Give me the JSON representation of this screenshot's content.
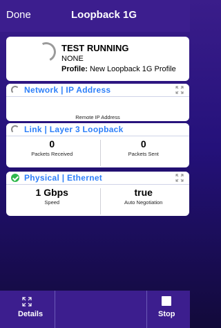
{
  "header": {
    "left_label": "Done",
    "title": "Loopback 1G"
  },
  "status_card": {
    "title": "TEST RUNNING",
    "subtitle": "NONE",
    "profile_label": "Profile:",
    "profile_value": "New Loopback 1G Profile"
  },
  "network_card": {
    "title": "Network | IP Address",
    "remote_ip_label": "Remote IP Address"
  },
  "link_card": {
    "title": "Link | Layer 3 Loopback",
    "left_value": "0",
    "left_label": "Packets Received",
    "right_value": "0",
    "right_label": "Packets Sent"
  },
  "physical_card": {
    "title": "Physical | Ethernet",
    "left_value": "1 Gbps",
    "left_label": "Speed",
    "right_value": "true",
    "right_label": "Auto Negotiation"
  },
  "toolbar": {
    "details_label": "Details",
    "stop_label": "Stop"
  },
  "colors": {
    "accent_blue": "#2d7ff9",
    "bar_purple": "#3c1e8e",
    "success_green": "#2fb84c"
  },
  "icons": [
    "spinner-icon",
    "expand-icon",
    "check-circle-icon",
    "stop-icon"
  ]
}
